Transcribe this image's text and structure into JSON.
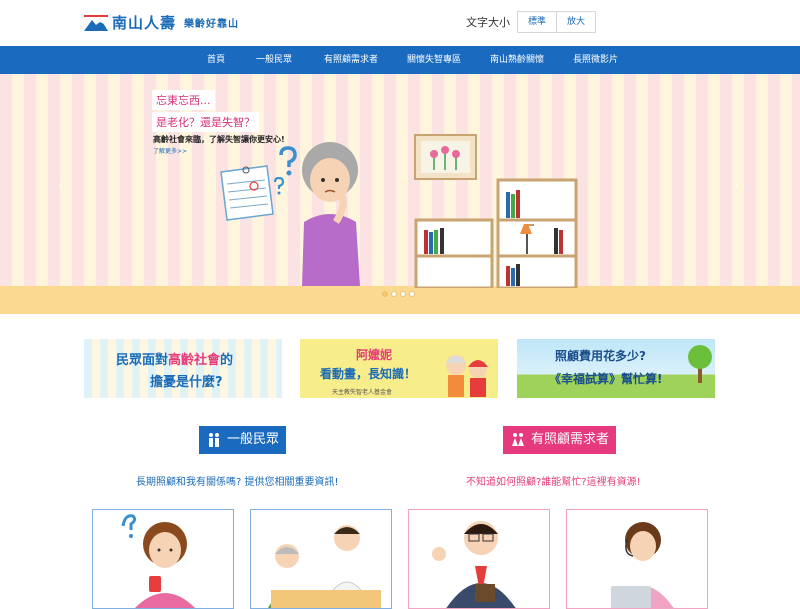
{
  "header": {
    "brand": "南山人壽",
    "slogan": "樂齡好靠山",
    "font_size_label": "文字大小",
    "font_size_options": [
      "標準",
      "放大"
    ]
  },
  "nav": {
    "items": [
      "首頁",
      "一般民眾",
      "有照顧需求者",
      "關懷失智專區",
      "南山熟齡關懷",
      "長照微影片"
    ]
  },
  "banner": {
    "line1": "忘東忘西...",
    "line2": "是老化？還是失智？",
    "desc": "高齡社會來臨，了解失智讓你更安心!",
    "more": "了解更多>>",
    "prev_icon": "chevron-left-icon",
    "next_icon": "chevron-right-icon",
    "active_slide": 1,
    "slide_count": 4
  },
  "promos": [
    {
      "line1_pre": "民眾面對",
      "line1_hl": "高齡社會",
      "line1_post": "的",
      "line2": "擔憂是什麼?"
    },
    {
      "title": "阿嬤妮",
      "subtitle": "看動畫，長知識！",
      "footer": "天主教失智老人基金會"
    },
    {
      "line1": "照顧費用花多少?",
      "line2": "《幸福試算》幫忙算!"
    }
  ],
  "sections": {
    "general": {
      "label": "一般民眾",
      "note": "長期照顧和我有關係嗎? 提供您相關重要資訊!"
    },
    "caregiver": {
      "label": "有照顧需求者",
      "note": "不知道如何照顧?誰能幫忙?這裡有資源!"
    }
  },
  "colors": {
    "brand_blue": "#1a6bc0",
    "brand_pink": "#e6397e"
  }
}
